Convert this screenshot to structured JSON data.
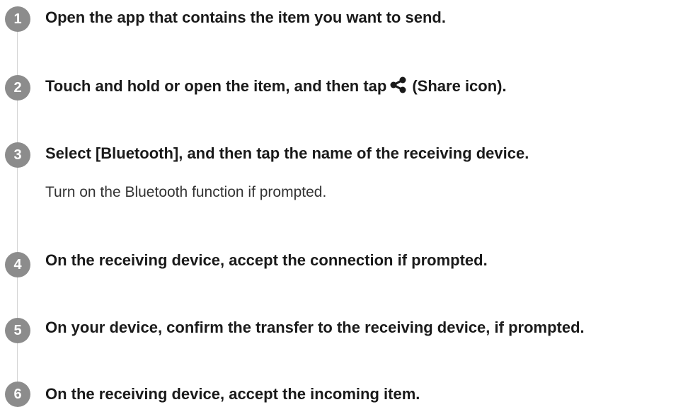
{
  "steps": [
    {
      "number": "1",
      "title": "Open the app that contains the item you want to send."
    },
    {
      "number": "2",
      "title_before": "Touch and hold or open the item, and then tap",
      "icon": "share-icon",
      "title_after": "(Share icon)."
    },
    {
      "number": "3",
      "title": "Select [Bluetooth], and then tap the name of the receiving device.",
      "description": "Turn on the Bluetooth function if prompted."
    },
    {
      "number": "4",
      "title": "On the receiving device, accept the connection if prompted."
    },
    {
      "number": "5",
      "title": "On your device, confirm the transfer to the receiving device, if prompted."
    },
    {
      "number": "6",
      "title": "On the receiving device, accept the incoming item."
    }
  ],
  "colors": {
    "badge": "#8c8c8c",
    "rail": "#d4d4d4",
    "text": "#1a1a1a"
  }
}
